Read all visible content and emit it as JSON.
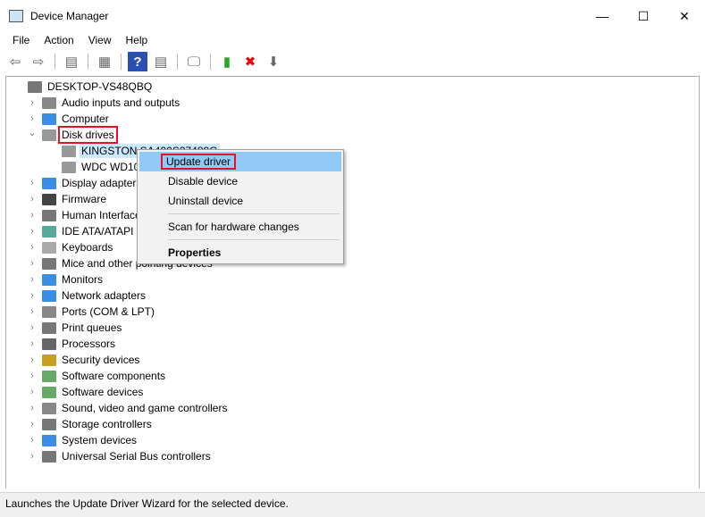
{
  "window": {
    "title": "Device Manager",
    "minimize": "—",
    "maximize": "☐",
    "close": "✕"
  },
  "menubar": [
    "File",
    "Action",
    "View",
    "Help"
  ],
  "toolbar": [
    {
      "icon": "back-arrow-icon",
      "glyph": "⇦"
    },
    {
      "icon": "forward-arrow-icon",
      "glyph": "⇨"
    },
    {
      "sep": true
    },
    {
      "icon": "show-hide-console-tree-icon",
      "glyph": "▤"
    },
    {
      "sep": true
    },
    {
      "icon": "properties-icon",
      "glyph": "▦"
    },
    {
      "sep": true
    },
    {
      "icon": "help-icon",
      "glyph": "?"
    },
    {
      "icon": "action-pane-icon",
      "glyph": "▤"
    },
    {
      "sep": true
    },
    {
      "icon": "scan-hardware-icon",
      "glyph": "🖵"
    },
    {
      "sep": true
    },
    {
      "icon": "update-driver-icon",
      "glyph": "▮"
    },
    {
      "icon": "uninstall-icon",
      "glyph": "✖"
    },
    {
      "icon": "disable-device-icon",
      "glyph": "⬇"
    }
  ],
  "tree": {
    "root": "DESKTOP-VS48QBQ",
    "items": [
      {
        "label": "Audio inputs and outputs",
        "color": "#888"
      },
      {
        "label": "Computer",
        "color": "#3a8ee6"
      },
      {
        "label": "Disk drives",
        "color": "#999",
        "expanded": true,
        "highlight": true,
        "children": [
          "KINGSTON SA400S37480G",
          "WDC WD10E"
        ]
      },
      {
        "label": "Display adapters",
        "color": "#3a8ee6"
      },
      {
        "label": "Firmware",
        "color": "#444"
      },
      {
        "label": "Human Interface Devices",
        "color": "#777"
      },
      {
        "label": "IDE ATA/ATAPI controllers",
        "color": "#5a9"
      },
      {
        "label": "Keyboards",
        "color": "#aaa"
      },
      {
        "label": "Mice and other pointing devices",
        "color": "#777"
      },
      {
        "label": "Monitors",
        "color": "#3a8ee6"
      },
      {
        "label": "Network adapters",
        "color": "#3a8ee6"
      },
      {
        "label": "Ports (COM & LPT)",
        "color": "#888"
      },
      {
        "label": "Print queues",
        "color": "#777"
      },
      {
        "label": "Processors",
        "color": "#666"
      },
      {
        "label": "Security devices",
        "color": "#c8a020"
      },
      {
        "label": "Software components",
        "color": "#6a6"
      },
      {
        "label": "Software devices",
        "color": "#6a6"
      },
      {
        "label": "Sound, video and game controllers",
        "color": "#888"
      },
      {
        "label": "Storage controllers",
        "color": "#777"
      },
      {
        "label": "System devices",
        "color": "#3a8ee6"
      },
      {
        "label": "Universal Serial Bus controllers",
        "color": "#777"
      }
    ]
  },
  "context_menu": {
    "items": [
      "Update driver",
      "Disable device",
      "Uninstall device"
    ],
    "scan": "Scan for hardware changes",
    "properties": "Properties"
  },
  "status": "Launches the Update Driver Wizard for the selected device.",
  "colors": {
    "highlight": "#e81123",
    "selection": "#cce8ff",
    "menu_active": "#91c9f7"
  }
}
